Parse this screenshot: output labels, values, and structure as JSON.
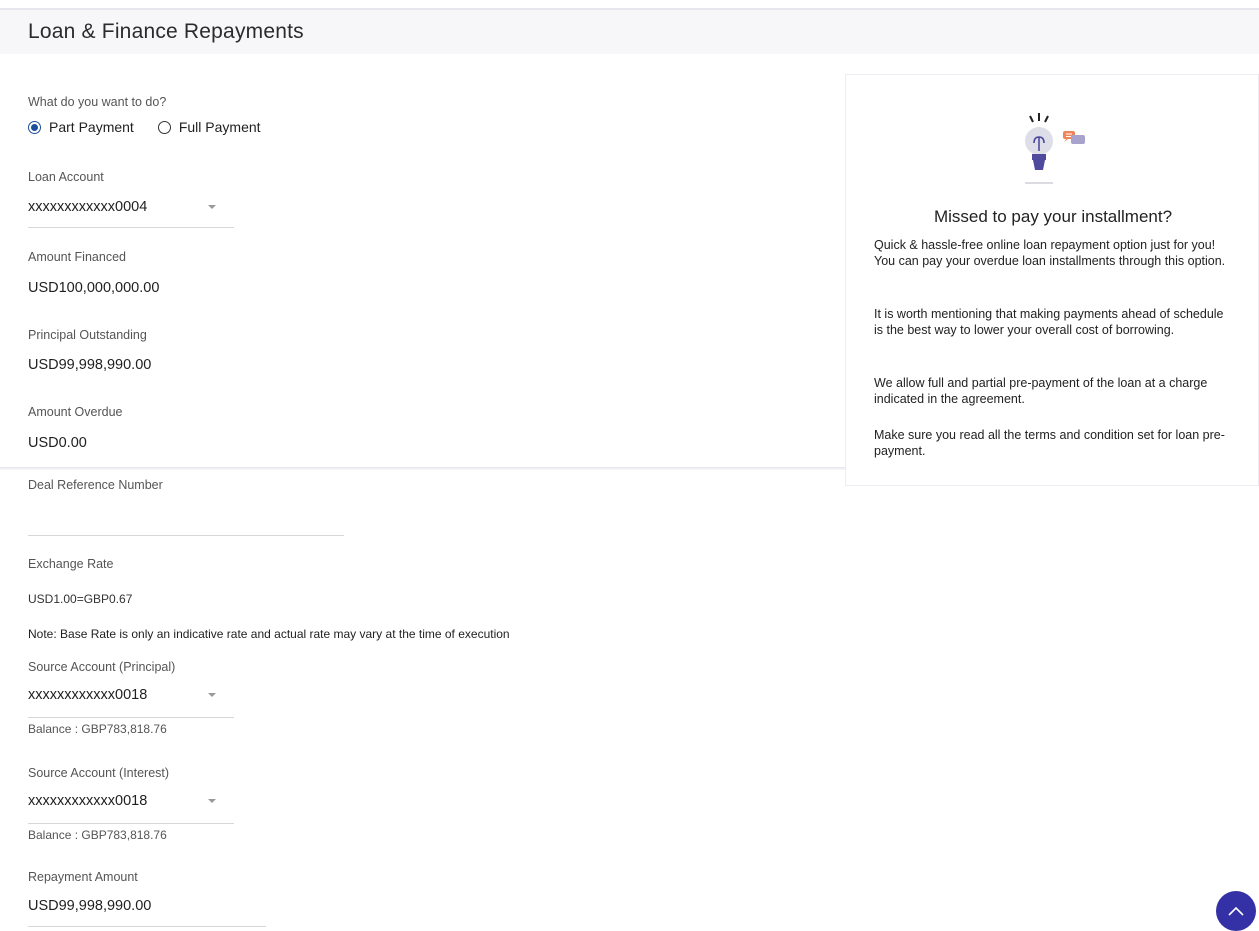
{
  "page": {
    "title": "Loan & Finance Repayments"
  },
  "payment_type": {
    "label": "What do you want to do?",
    "options": [
      {
        "label": "Part Payment",
        "selected": true
      },
      {
        "label": "Full Payment",
        "selected": false
      }
    ]
  },
  "loan_account": {
    "label": "Loan Account",
    "value": "xxxxxxxxxxxx0004"
  },
  "amount_financed": {
    "label": "Amount Financed",
    "value": "USD100,000,000.00"
  },
  "principal_outstanding": {
    "label": "Principal Outstanding",
    "value": "USD99,998,990.00"
  },
  "amount_overdue": {
    "label": "Amount Overdue",
    "value": "USD0.00"
  },
  "deal_reference": {
    "label": "Deal Reference Number",
    "value": ""
  },
  "exchange_rate": {
    "label": "Exchange Rate",
    "value": "USD1.00=GBP0.67",
    "note": "Note: Base Rate is only an indicative rate and actual rate may vary at the time of execution"
  },
  "source_principal": {
    "label": "Source Account (Principal)",
    "value": "xxxxxxxxxxxx0018",
    "balance": "Balance : GBP783,818.76"
  },
  "source_interest": {
    "label": "Source Account (Interest)",
    "value": "xxxxxxxxxxxx0018",
    "balance": "Balance : GBP783,818.76"
  },
  "repayment_amount": {
    "label": "Repayment Amount",
    "value": "USD99,998,990.00"
  },
  "info_panel": {
    "title": "Missed to pay your installment?",
    "paragraphs": [
      "Quick & hassle-free online loan repayment option just for you! You can pay your overdue loan installments through this option.",
      "It is worth mentioning that making payments ahead of schedule is the best way to lower your overall cost of borrowing.",
      "We allow full and partial pre-payment of the loan at a charge indicated in the agreement.",
      "Make sure you read all the terms and condition set for loan pre-payment."
    ]
  },
  "colors": {
    "accent": "#3430a6",
    "radio_selected": "#1c4f9c",
    "bulb_fill": "#4f4a9e",
    "chat_orange": "#f0855a"
  },
  "icons": {
    "illustration": "lightbulb-icon",
    "scroll_top": "chevron-up-icon"
  }
}
